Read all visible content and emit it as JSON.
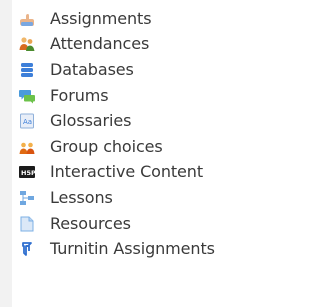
{
  "activities": [
    {
      "label": "Assignments",
      "icon": "assignment-hand-icon",
      "color": "#e4914a"
    },
    {
      "label": "Attendances",
      "icon": "attendance-people-icon",
      "color": "#d96b1e"
    },
    {
      "label": "Databases",
      "icon": "database-icon",
      "color": "#3d7fd9"
    },
    {
      "label": "Forums",
      "icon": "forum-chat-icon",
      "color": "#4a9bdb"
    },
    {
      "label": "Glossaries",
      "icon": "glossary-book-icon",
      "color": "#5b8fd6"
    },
    {
      "label": "Group choices",
      "icon": "group-choice-people-icon",
      "color": "#e06a12"
    },
    {
      "label": "Interactive Content",
      "icon": "h5p-icon",
      "color": "#1b1b1b"
    },
    {
      "label": "Lessons",
      "icon": "lesson-flow-icon",
      "color": "#6fa7e0"
    },
    {
      "label": "Resources",
      "icon": "resource-file-icon",
      "color": "#7db0e6"
    },
    {
      "label": "Turnitin Assignments",
      "icon": "turnitin-icon",
      "color": "#2f6fcf"
    }
  ]
}
